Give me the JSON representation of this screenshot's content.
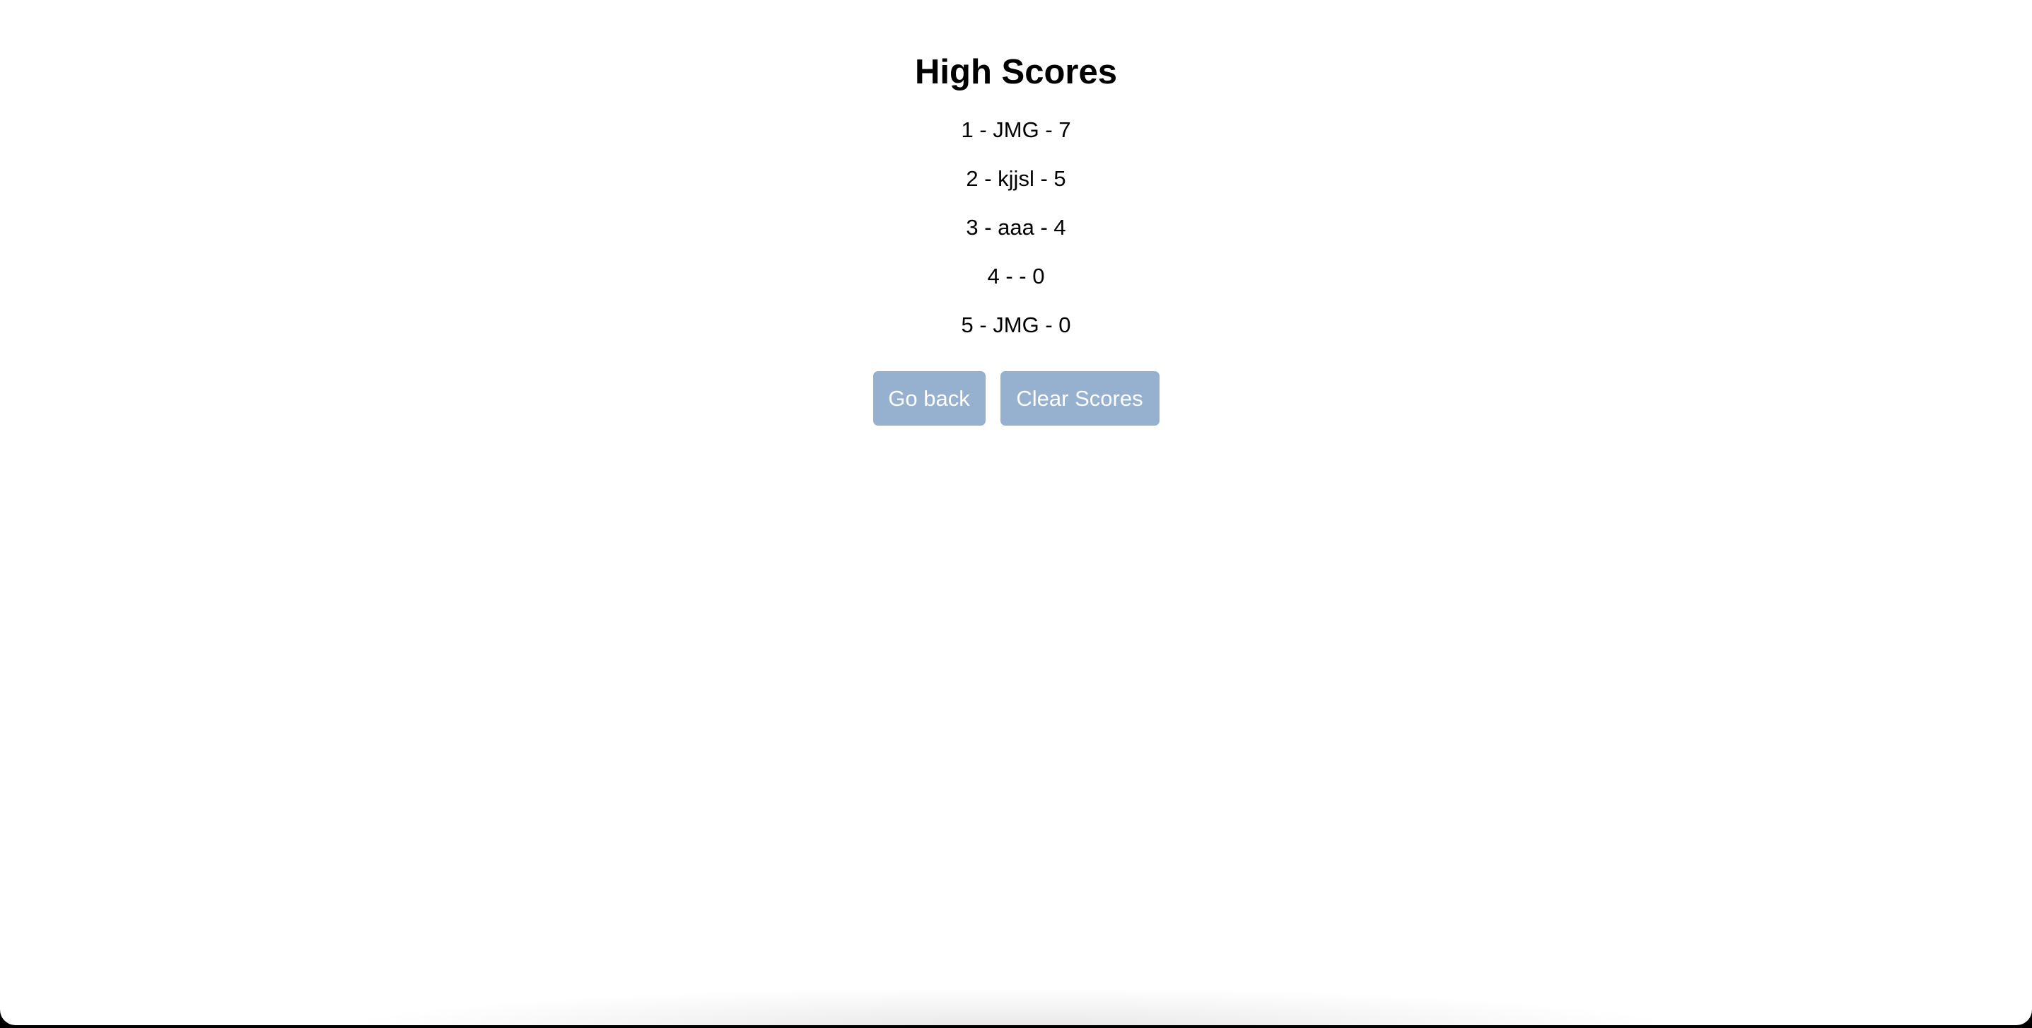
{
  "page": {
    "title": "High Scores"
  },
  "scores": [
    {
      "text": "1 - JMG - 7"
    },
    {
      "text": "2 - kjjsl - 5"
    },
    {
      "text": "3 - aaa - 4"
    },
    {
      "text": "4 - - 0"
    },
    {
      "text": "5 - JMG - 0"
    }
  ],
  "actions": {
    "back_label": "Go back",
    "clear_label": "Clear Scores"
  },
  "colors": {
    "button_bg": "#96b0d0",
    "button_text": "#ffffff",
    "background": "#ffffff"
  }
}
